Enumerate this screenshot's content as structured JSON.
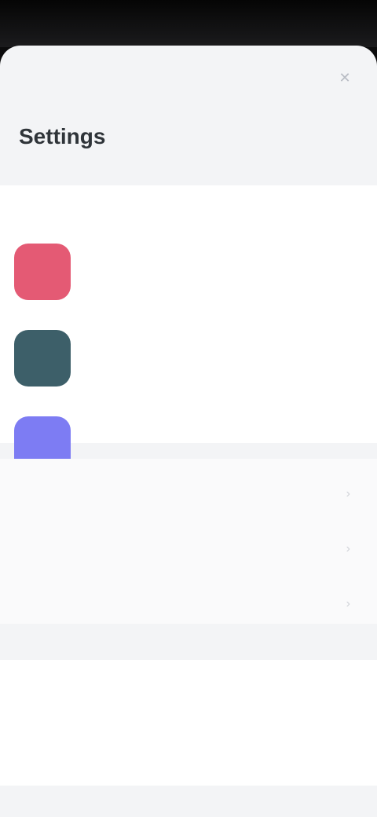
{
  "sheet": {
    "title": "Settings"
  },
  "apps": [
    {
      "name": "",
      "description": "",
      "color": "#e45a74"
    },
    {
      "name": "",
      "description": "",
      "color": "#3d5f69"
    },
    {
      "name": "",
      "description": "",
      "color": "#7d7cf3"
    }
  ],
  "menu": {
    "items": [
      {
        "label": ""
      },
      {
        "label": ""
      },
      {
        "label": ""
      }
    ]
  },
  "language": {
    "label": "",
    "value": ""
  },
  "footer": {
    "manage_label": ""
  }
}
